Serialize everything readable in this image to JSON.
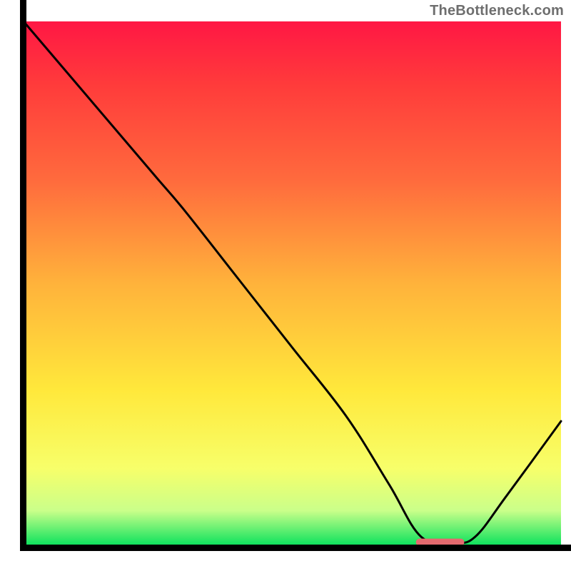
{
  "attribution": "TheBottleneck.com",
  "chart_data": {
    "type": "line",
    "title": "",
    "xlabel": "",
    "ylabel": "",
    "xlim": [
      0,
      100
    ],
    "ylim": [
      0,
      100
    ],
    "series": [
      {
        "name": "curve",
        "x": [
          0,
          20,
          25,
          30,
          40,
          50,
          60,
          68,
          74,
          80,
          84,
          90,
          100
        ],
        "values": [
          100,
          76,
          70,
          64,
          51,
          38,
          25,
          12,
          2,
          1,
          2,
          10,
          24
        ]
      }
    ],
    "marker": {
      "x_start": 73,
      "x_end": 82,
      "y": 1
    },
    "background_gradient": {
      "stops": [
        {
          "pos": 0.0,
          "color": "#ff1744"
        },
        {
          "pos": 0.12,
          "color": "#ff3b3b"
        },
        {
          "pos": 0.3,
          "color": "#ff6a3d"
        },
        {
          "pos": 0.5,
          "color": "#ffb33b"
        },
        {
          "pos": 0.7,
          "color": "#ffe83b"
        },
        {
          "pos": 0.85,
          "color": "#f7ff6a"
        },
        {
          "pos": 0.93,
          "color": "#caff8a"
        },
        {
          "pos": 1.0,
          "color": "#00e05a"
        }
      ]
    },
    "axes": {
      "margin_left": 33,
      "margin_bottom": 33,
      "margin_top": 30,
      "margin_right": 14,
      "stroke": "#000000",
      "stroke_width": 9
    },
    "curve_style": {
      "stroke": "#000000",
      "stroke_width": 3
    },
    "marker_style": {
      "fill": "#e46a6f",
      "height": 10,
      "rx": 5
    }
  }
}
